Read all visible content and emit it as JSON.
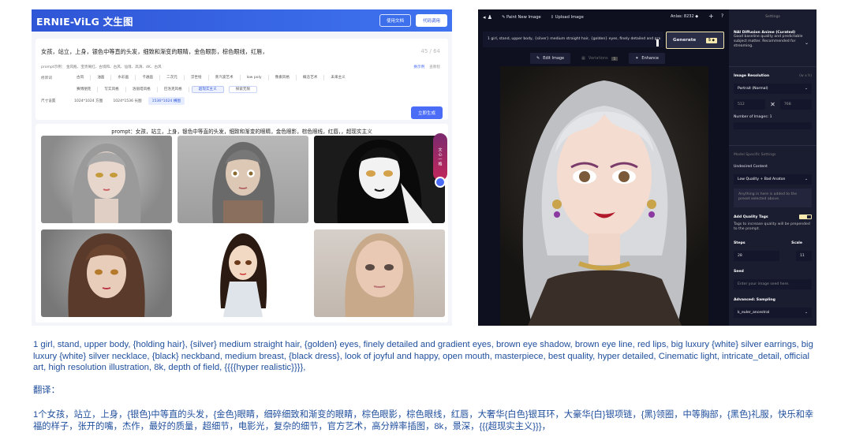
{
  "ernie": {
    "title": "ERNIE-ViLG 文生图",
    "header_buttons": [
      "使用文档",
      "代码调用"
    ],
    "prompt": "女孩，站立，上身，银色中等直的头发，细致和渐变的眼睛，金色眼影，棕色眼线，红唇，",
    "char_count": "45 / 64",
    "example_line": "prompt示例： 金风瓶、宝贵阁红、古境和、古风、仙境、高清、4K、古风",
    "links": [
      "换示例",
      "查教程"
    ],
    "style_label": "修饰词",
    "styles_row1": [
      "古风",
      "油画",
      "水彩画",
      "卡通画",
      "二次元",
      "浮世绘",
      "蒸汽波艺术",
      "low poly",
      "像素风格",
      "概念艺术",
      "未来主义"
    ],
    "styles_row2": [
      "赛博朋克",
      "写实风格",
      "洛丽塔风格",
      "巴洛克风格",
      "超现实主义",
      "探索无限"
    ],
    "size_label": "尺寸设置",
    "sizes": [
      "1024*1024 方图",
      "1024*1536 长图",
      "1536*1024 横图"
    ],
    "generate_label": "立即生成",
    "result_prompt": "prompt：女孩，站立，上身，银色中等直的头发，细致和渐变的眼睛，金色眼影，棕色眼线，红唇，，超现实主义",
    "float_label": "文心一格"
  },
  "nai": {
    "top_links": [
      "Paint New Image",
      "Upload Image"
    ],
    "anlas": "Anlas: 8232",
    "prompt": "1 girl, stand, upper body, {silver} medium straight hair, {golden} eyes, finely detailed and gra",
    "generate": "Generate",
    "generate_cost": "5",
    "tools": [
      "Edit Image",
      "Variations",
      "Enhance"
    ],
    "variations_cost": "5",
    "settings_header": "Settings",
    "model_title": "NAI Diffusion Anime (Curated)",
    "model_desc": "Good baseline quality and predictable subject matter. Recommended for streaming.",
    "resolution_label": "Image Resolution",
    "resolution_unit": "(w x h)",
    "resolution_value": "Portrait (Normal)",
    "width": "512",
    "height": "768",
    "num_images": "Number of Images: 1",
    "model_settings": "Model Specific Settings",
    "undesired_label": "Undesired Content",
    "undesired_value": "Low Quality + Bad Anaton",
    "undesired_placeholder": "Anything in here is added to the preset selected above.",
    "quality_tags": "Add Quality Tags",
    "quality_desc": "Tags to increase quality will be prepended to the prompt.",
    "steps_label": "Steps",
    "steps": "28",
    "scale_label": "Scale",
    "scale": "11",
    "seed_label": "Seed",
    "seed_placeholder": "Enter your image seed here.",
    "sampling_label": "Advanced: Sampling",
    "sampling_value": "k_euler_ancestral"
  },
  "caption": {
    "english": "1 girl, stand, upper body, {holding hair}, {silver} medium straight hair,  {golden} eyes, finely detailed and gradient eyes, brown eye shadow, brown eye line, red lips, big luxury {white} silver earrings, big luxury {white} silver necklace, {black} neckband, medium breast, {black dress}, look of joyful and happy, open mouth, masterpiece, best quality, hyper detailed, Cinematic light, intricate_detail, official art, high resolution illustration, 8k, depth of field, {{{{hyper realistic}}}},",
    "translation_label": "翻译：",
    "chinese": "1个女孩，站立，上身，{银色}中等直的头发，{金色}眼睛，细碎细致和渐变的眼睛，棕色眼影，棕色眼线，红唇，大奢华{白色}银耳环，大豪华{白}银项链，{黑}领圈，中等胸部，{黑色}礼服，快乐和幸福的样子，张开的嘴，杰作，最好的质量，超细节，电影光，复杂的细节，官方艺术，高分辨率插图，8k，景深，{{{超现实主义}}}，"
  }
}
